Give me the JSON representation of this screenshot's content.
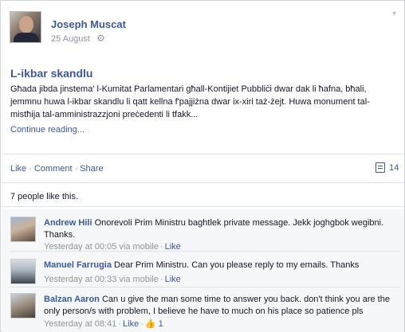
{
  "post": {
    "author": "Joseph Muscat",
    "date": "25 August",
    "privacy_icon": "gear-icon",
    "title": "L-ikbar skandlu",
    "body": "Għada jibda jinstema' l-Kumitat Parlamentari għall-Kontijiet Pubbliċi dwar dak li ħafna, bħali, jemmnu huwa l-ikbar skandlu li qatt kellna f'pajjiżna dwar ix-xiri taż-żejt. Huwa monument tal-mistħija tal-amministrazzjoni preċedenti li tfakk...",
    "continue_label": "Continue reading..."
  },
  "actions": {
    "like": "Like",
    "comment": "Comment",
    "share": "Share",
    "comment_count": "14"
  },
  "likes_text": "7 people like this.",
  "comments": [
    {
      "name": "Andrew Hili",
      "text": "Onorevoli Prim Ministru baghtlek private message. Jekk joghgbok wegibni. Thanks.",
      "time": "Yesterday at 00:05 via mobile",
      "like": "Like",
      "like_count": ""
    },
    {
      "name": "Manuel Farrugia",
      "text": "Dear Prim Ministru. Can you please reply to my emails. Thanks",
      "time": "Yesterday at 00:33 via mobile",
      "like": "Like",
      "like_count": ""
    },
    {
      "name": "Balzan Aaron",
      "text": "Can u give the man some time to answer you back. don't think you are the only person/s with problem, I believe he have to much on his place so patience pls",
      "time": "Yesterday at 08:41",
      "like": "Like",
      "like_count": "1"
    }
  ],
  "colors": {
    "link": "#3b5998",
    "meta": "#90949c",
    "comment_bg": "#f6f7f9"
  }
}
